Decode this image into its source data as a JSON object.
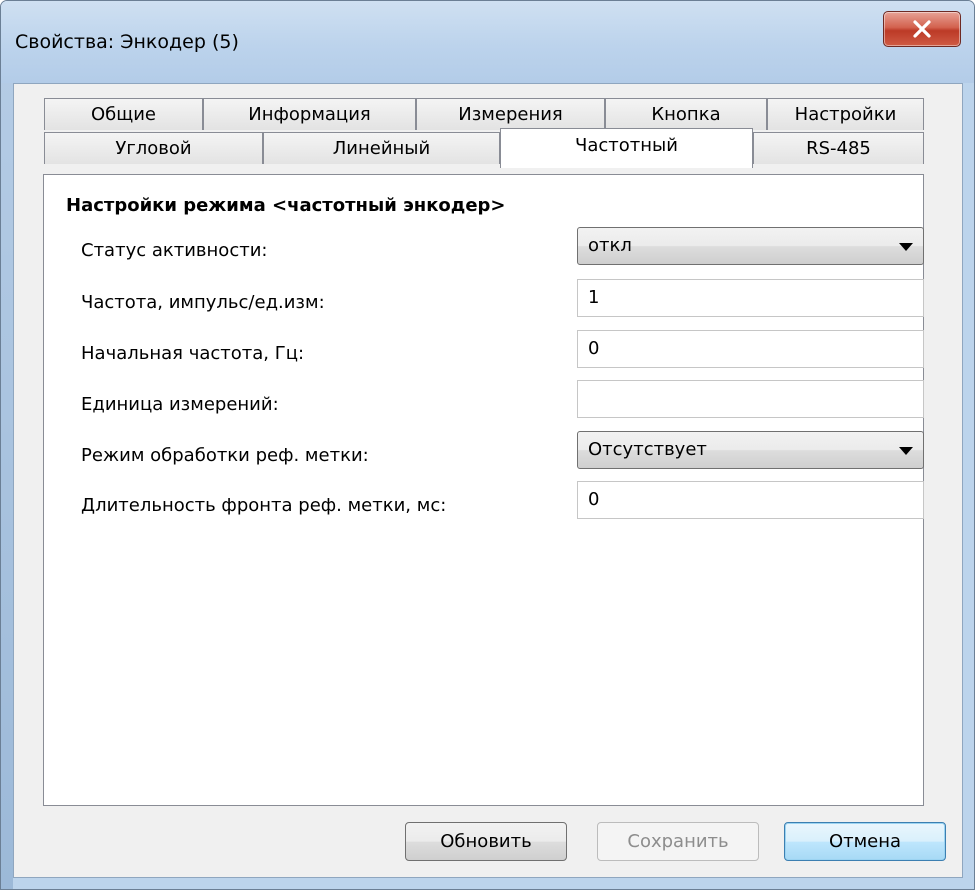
{
  "window": {
    "title": "Свойства: Энкодер (5)",
    "close_glyph": "x"
  },
  "tabs": {
    "row_top": [
      "Общие",
      "Информация",
      "Измерения",
      "Кнопка",
      "Настройки"
    ],
    "row_bottom": [
      "Угловой",
      "Линейный",
      "Частотный",
      "RS-485"
    ],
    "active": "Частотный"
  },
  "panel": {
    "section_title": "Настройки режима <частотный энкодер>",
    "fields": {
      "status_label": "Статус активности:",
      "status_value": "откл",
      "frequency_label": "Частота, импульс/ед.изм:",
      "frequency_value": "1",
      "start_freq_label": "Начальная частота, Гц:",
      "start_freq_value": "0",
      "unit_label": "Единица измерений:",
      "unit_value": "",
      "ref_mode_label": "Режим обработки реф. метки:",
      "ref_mode_value": "Отсутствует",
      "ref_duration_label": "Длительность фронта реф. метки, мс:",
      "ref_duration_value": "0"
    }
  },
  "buttons": {
    "refresh": "Обновить",
    "save": "Сохранить",
    "cancel": "Отмена"
  }
}
